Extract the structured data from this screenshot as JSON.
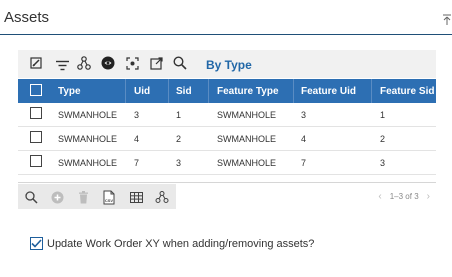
{
  "panel": {
    "title": "Assets"
  },
  "toolbar": {
    "by_type_label": "By Type"
  },
  "grid": {
    "columns": [
      "Type",
      "Uid",
      "Sid",
      "Feature Type",
      "Feature Uid",
      "Feature Sid"
    ],
    "rows": [
      {
        "type": "SWMANHOLE",
        "uid": "3",
        "sid": "1",
        "feature_type": "SWMANHOLE",
        "feature_uid": "3",
        "feature_sid": "1"
      },
      {
        "type": "SWMANHOLE",
        "uid": "4",
        "sid": "2",
        "feature_type": "SWMANHOLE",
        "feature_uid": "4",
        "feature_sid": "2"
      },
      {
        "type": "SWMANHOLE",
        "uid": "7",
        "sid": "3",
        "feature_type": "SWMANHOLE",
        "feature_uid": "7",
        "feature_sid": "3"
      }
    ]
  },
  "footer": {
    "export_label": "CSV",
    "pager_text": "1–3 of 3",
    "prev_arrow": "‹",
    "next_arrow": "›"
  },
  "options": {
    "update_work_order_xy_label": "Update Work Order XY when adding/removing assets?",
    "update_work_order_xy_checked": true
  },
  "colors": {
    "header_bg": "#2d6fb3",
    "accent": "#2167a7",
    "rule": "#1f4f78"
  },
  "icons": {
    "toolbar": [
      "edit-icon",
      "filter-icon",
      "relationships-icon",
      "layer-visibility-icon",
      "zoom-to-extent-icon",
      "open-external-icon",
      "search-icon"
    ],
    "footer": [
      "search-icon",
      "add-icon",
      "delete-icon",
      "export-csv-icon",
      "grid-view-icon",
      "hierarchy-icon"
    ]
  }
}
